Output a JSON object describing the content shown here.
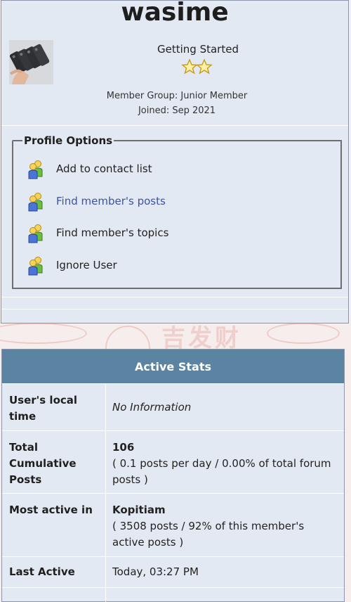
{
  "profile": {
    "username": "wasime",
    "rank_title": "Getting Started",
    "member_group": "Member Group: Junior Member",
    "joined": "Joined: Sep 2021",
    "rank_stars": 2
  },
  "options": {
    "legend": "Profile Options",
    "items": [
      {
        "label": "Add to contact list",
        "link": false
      },
      {
        "label": "Find member's posts",
        "link": true
      },
      {
        "label": "Find member's topics",
        "link": false
      },
      {
        "label": "Ignore User",
        "link": false
      }
    ]
  },
  "stats": {
    "header": "Active Stats",
    "rows": [
      {
        "label": "User's local time",
        "value": "No Information"
      },
      {
        "label": "Total Cumulative Posts",
        "value_strong": "106",
        "value": "( 0.1 posts per day / 0.00% of total forum posts )"
      },
      {
        "label": "Most active in",
        "value_strong": "Kopitiam",
        "value": "( 3508 posts / 92% of this member's active posts )"
      },
      {
        "label": "Last Active",
        "value": "Today, 03:27 PM"
      }
    ]
  },
  "colors": {
    "card_bg": "#e3e9f3",
    "header_bg": "#5a84a1",
    "link": "#3d53a0"
  },
  "icons": {
    "option_icon": "contacts-people-icon",
    "rank_star": "star-icon"
  }
}
